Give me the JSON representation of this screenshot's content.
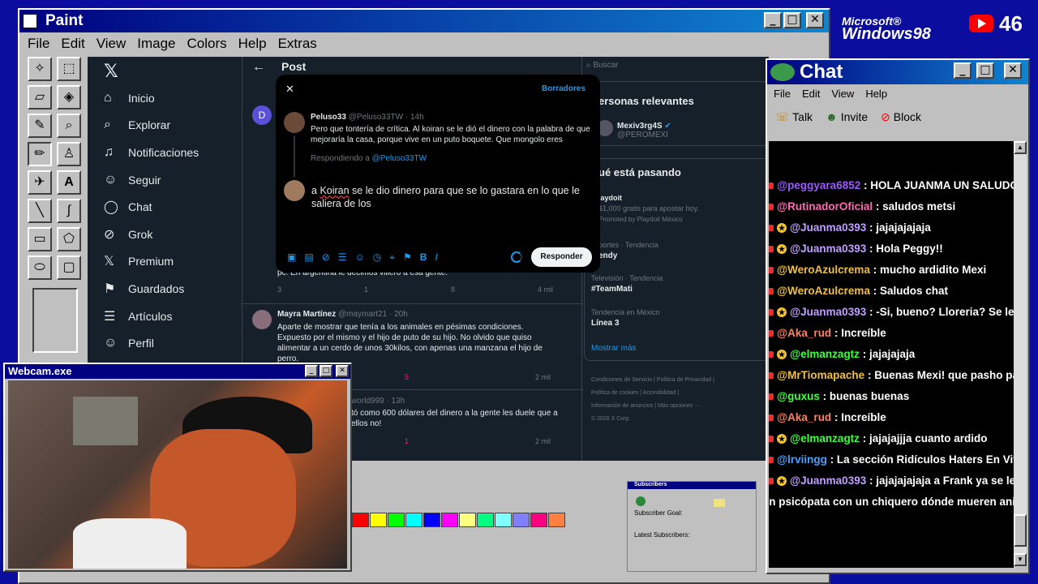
{
  "paint": {
    "title": "Paint",
    "menu": [
      "File",
      "Edit",
      "View",
      "Image",
      "Colors",
      "Help",
      "Extras"
    ],
    "palette": [
      "#ff0000",
      "#ffff00",
      "#00ff00",
      "#00ffff",
      "#0000ff",
      "#ff00ff",
      "#ffff80",
      "#00ff80",
      "#80ffff",
      "#8080ff",
      "#ff0080",
      "#ff8040"
    ]
  },
  "x": {
    "nav": [
      "Inicio",
      "Explorar",
      "Notificaciones",
      "Seguir",
      "Chat",
      "Grok",
      "Premium",
      "Guardados",
      "Artículos",
      "Perfil"
    ],
    "back_label": "Post",
    "search_placeholder": "Buscar",
    "relevant_title": "ersonas relevantes",
    "relevant_user": "Mexiv3rg4S",
    "relevant_handle": "@PEROMEXI",
    "happening_title": "ué está pasando",
    "ad_title": "laydoit",
    "ad_text": "$1,000 gratis para apostar hoy.",
    "ad_promo": "Promoted by Playdoit México",
    "trend1_cat": "portes · Tendencia",
    "trend1_name": "endy",
    "trend2_cat": "Televisión · Tendencia",
    "trend2_name": "#TeamMati",
    "trend3_cat": "Tendencia en México",
    "trend3_name": "Línea 3",
    "show_more": "Mostrar más",
    "footer1": "Condiciones de Servicio  |  Política de Privacidad  |",
    "footer2": "Política de cookies  |  Accesibilidad  |",
    "footer3": "Información de anuncios  |  Más opciones ···",
    "footer4": "© 2026 X Corp.",
    "bg_avatar_letter": "D",
    "bg_post1_text": "pc. En argentina le decimos villero a esa gente.",
    "bg_post1_stats": [
      "3",
      "1",
      "8",
      "4 mil"
    ],
    "bg_post2_user": "Mayra Martínez",
    "bg_post2_handle": "@maymart21 · 20h",
    "bg_post2_text": "Aparte de mostrar que tenía a los animales en pésimas condiciones. Expuesto por el mismo y el hijo de puto de su hijo. No olvido que quiso alimentar a un cerdo de unos 30kilos, con apenas una manzana el hijo de perro.",
    "bg_post2_stats": [
      "5",
      "2 mil"
    ],
    "bg_post3_handle": "world999 · 13h",
    "bg_post3_text": "tó como 600 dólares del dinero a la gente les duele que a ellos no!",
    "bg_post3_stats": [
      "1",
      "2 mil"
    ]
  },
  "modal": {
    "close": "✕",
    "drafts": "Borradores",
    "orig_user": "Peluso33",
    "orig_meta": "@Peluso33TW · 14h",
    "orig_text": "Pero que tontería de crítica. Al koiran se le dió el dinero con la palabra de que mejoraría la casa, porque vive en un puto boquete. Que mongolo eres",
    "replying_prefix": "Respondiendo a",
    "replying_handle": "@Peluso33TW",
    "reply_text_a": "a",
    "reply_text_name": "Koiran",
    "reply_text_rest": " se le dio dinero para que se lo gastara en lo que le saliera de los",
    "reply_button": "Responder"
  },
  "chat": {
    "title": "Chat",
    "menu": [
      "File",
      "Edit",
      "View",
      "Help"
    ],
    "toolbar": [
      "Talk",
      "Invite",
      "Block"
    ],
    "messages": [
      {
        "user": "@peggyara6852",
        "text": "HOLA JUANMA UN SALUDO",
        "color": "#9b59ff",
        "star": false
      },
      {
        "user": "@RutinadorOficial",
        "text": "saludos metsi",
        "color": "#ff69b4",
        "star": false
      },
      {
        "user": "@Juanma0393",
        "text": "jajajajajaja",
        "color": "#c0a0ff",
        "star": true
      },
      {
        "user": "@Juanma0393",
        "text": "Hola Peggy!!",
        "color": "#c0a0ff",
        "star": true
      },
      {
        "user": "@WeroAzulcrema",
        "text": "mucho ardidito Mexi",
        "color": "#f0c040",
        "star": false
      },
      {
        "user": "@WeroAzulcrema",
        "text": "Saludos chat",
        "color": "#f0c040",
        "star": false
      },
      {
        "user": "@Juanma0393",
        "text": "-Si, bueno? Lloreria? Se le escap",
        "color": "#c0a0ff",
        "star": true
      },
      {
        "user": "@Aka_rud",
        "text": "Increíble",
        "color": "#ff8060",
        "star": false
      },
      {
        "user": "@elmanzagtz",
        "text": "jajajajaja",
        "color": "#40ff40",
        "star": true
      },
      {
        "user": "@MrTiomapache",
        "text": "Buenas Mexi! que pasho pasho",
        "color": "#f0c040",
        "star": false
      },
      {
        "user": "@guxus",
        "text": "buenas buenas",
        "color": "#40ff40",
        "star": false
      },
      {
        "user": "@Aka_rud",
        "text": "Increíble",
        "color": "#ff8060",
        "star": false
      },
      {
        "user": "@elmanzagtz",
        "text": "jajajajjja cuanto ardido",
        "color": "#40ff40",
        "star": true
      },
      {
        "user": "@lrviingg",
        "text": "La sección Ridículos Haters En Vivo o",
        "color": "#4aa0ff",
        "star": false
      },
      {
        "user": "@Juanma0393",
        "text": "jajajajajaja a Frank ya se le fundi",
        "color": "#c0a0ff",
        "star": true
      }
    ],
    "last_line": "un psicópata con un chiquero dónde mueren animales"
  },
  "webcam": {
    "title": "Webcam.exe"
  },
  "subs": {
    "title": "Subscribers",
    "goal": "Subscriber Goal:",
    "latest": "Latest Subscribers:"
  },
  "brand": {
    "ms": "Microsoft®",
    "win": "Windows98",
    "yt_count": "46"
  }
}
